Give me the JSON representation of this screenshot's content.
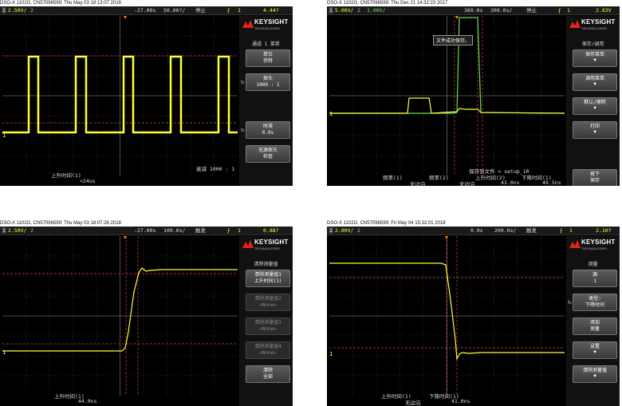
{
  "brand": {
    "name": "KEYSIGHT",
    "sub": "TECHNOLOGIES"
  },
  "colors": {
    "ch1": "#ffff33",
    "ch2": "#66dd55",
    "grid": "#555555",
    "cursor": "#cc4422"
  },
  "panels": [
    {
      "caption": "DSO-X 1102G, CN57096599: Thu May 03 18:13:07 2018",
      "status": {
        "ch1": "2.50V/",
        "ch1_num": "1",
        "ch2": "2",
        "delay": "-27.00s",
        "timebase": "50.00?/",
        "mode": "停止",
        "trig_ch": "1",
        "trig_lvl": "4.44?"
      },
      "sidebar": {
        "title": "通道 1 菜单",
        "buttons": [
          {
            "l1": "单位",
            "l2": "伏特",
            "dim": false
          },
          {
            "l1": "探头",
            "l2": "1000 : 1",
            "dim": false
          },
          {
            "l1": "时滞",
            "l2": "0.0s",
            "dim": false
          },
          {
            "l1": "无源探头",
            "l2": "检查",
            "dim": false
          }
        ]
      },
      "meas": {
        "label": "上升时间(1)",
        "value": "<24us",
        "right": "衰减 1000 : 1"
      }
    },
    {
      "caption": "DSO-X 1102G, CN57096599: Thu Dec 21 14:32:23 2017",
      "status": {
        "ch1": "5.00V/",
        "ch1_num": "1",
        "ch2": "2",
        "ch2_scale": "1.00V/",
        "delay": "360.0s",
        "timebase": "200.0s/",
        "mode": "停止",
        "trig_ch": "1",
        "trig_lvl": "2.83V"
      },
      "sidebar": {
        "title": "保存/调用",
        "buttons": [
          {
            "l1": "保存菜单",
            "l2": "",
            "dim": false
          },
          {
            "l1": "调用菜单",
            "l2": "",
            "dim": false
          },
          {
            "l1": "默认/擦除",
            "l2": "",
            "dim": false
          },
          {
            "l1": "打印",
            "l2": "",
            "dim": false
          },
          {
            "l1": "按下",
            "l2": "保存",
            "dim": false
          }
        ]
      },
      "message": "文件成功保存。",
      "save_line": "保存到文件 = setup_10",
      "meas_items": [
        {
          "label": "频率(1)",
          "value": ""
        },
        {
          "label": "频率(2)",
          "value": "无边沿"
        },
        {
          "label": "上升时间(2)",
          "value": "无边沿"
        },
        {
          "label": "下降时间(1)",
          "value": "43.0ns"
        },
        {
          "label": "",
          "value": "49.5ns"
        }
      ]
    },
    {
      "caption": "DSO-X 1102G, CN57096599: Thu May 03 18:07:26 2018",
      "status": {
        "ch1": "2.50V/",
        "ch1_num": "1",
        "ch2": "2",
        "delay": "-27.00s",
        "timebase": "100.0s/",
        "mode": "触发",
        "trig_ch": "1",
        "trig_lvl": "0.88?"
      },
      "sidebar": {
        "title": "清除测量值",
        "buttons": [
          {
            "l1": "清除测量值1",
            "l2": "上升时间(1)",
            "dim": false
          },
          {
            "l1": "清除测量值2",
            "l2": "<None>",
            "dim": true
          },
          {
            "l1": "清除测量值3",
            "l2": "<None>",
            "dim": true
          },
          {
            "l1": "清除测量值4",
            "l2": "<None>",
            "dim": true
          },
          {
            "l1": "清除",
            "l2": "全部",
            "dim": false
          }
        ]
      },
      "meas": {
        "label": "上升时间(1)",
        "value": "44.0ns"
      }
    },
    {
      "caption": "DSO-X 1102G, CN57096599: Fri May 04 15:32:01 2018",
      "status": {
        "ch1": "2.00V/",
        "ch1_num": "1",
        "ch2": "2",
        "delay": "0.0s",
        "timebase": "200.0s/",
        "mode": "触发",
        "trig_ch": "1",
        "trig_lvl": "2.10?"
      },
      "sidebar": {
        "title": "测量",
        "buttons": [
          {
            "l1": "源",
            "l2": "1",
            "dim": false
          },
          {
            "l1": "类型:",
            "l2": "下降时间",
            "dim": false
          },
          {
            "l1": "添加",
            "l2": "测量",
            "dim": false
          },
          {
            "l1": "设置",
            "l2": "",
            "dim": false
          },
          {
            "l1": "清除测量值",
            "l2": "",
            "dim": false
          }
        ]
      },
      "meas_items": [
        {
          "label": "上升时间(1)",
          "value": "无边沿"
        },
        {
          "label": "下降时间(1)",
          "value": "41.0ns"
        }
      ]
    }
  ]
}
